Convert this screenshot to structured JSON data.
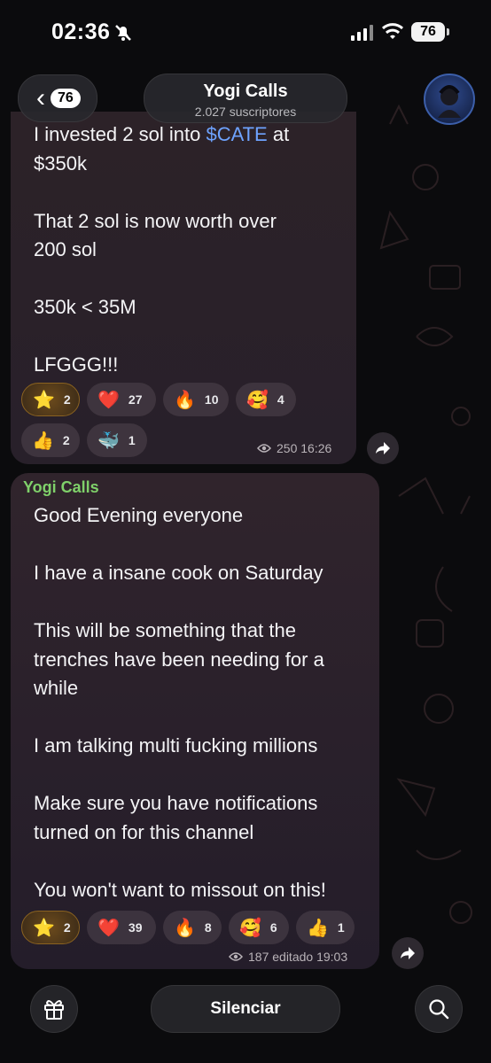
{
  "status_bar": {
    "time": "02:36",
    "battery": "76"
  },
  "header": {
    "back_count": "76",
    "channel_name": "Yogi Calls",
    "subscribers": "2.027 suscriptores"
  },
  "message1": {
    "line1_prefix": "I invested 2 sol into ",
    "line1_link": "$CATE",
    "line1_suffix": " at",
    "body": "$350k\n\nThat 2 sol is now worth over\n200 sol\n\n350k < 35M\n\nLFGGG!!!",
    "reactions": [
      {
        "emoji": "⭐",
        "count": "2"
      },
      {
        "emoji": "❤️",
        "count": "27"
      },
      {
        "emoji": "🔥",
        "count": "10"
      },
      {
        "emoji": "🥰",
        "count": "4"
      },
      {
        "emoji": "👍",
        "count": "2"
      },
      {
        "emoji": "🐳",
        "count": "1"
      }
    ],
    "meta": "250 16:26"
  },
  "message2": {
    "sender": "Yogi Calls",
    "body": "Good Evening everyone\n\nI have a insane cook on Saturday\n\nThis will be something that the\ntrenches have been needing for a\nwhile\n\nI am talking multi fucking millions\n\nMake sure you have notifications\nturned on for this channel\n\nYou won't want to missout on this!",
    "reactions": [
      {
        "emoji": "⭐",
        "count": "2"
      },
      {
        "emoji": "❤️",
        "count": "39"
      },
      {
        "emoji": "🔥",
        "count": "8"
      },
      {
        "emoji": "🥰",
        "count": "6"
      },
      {
        "emoji": "👍",
        "count": "1"
      }
    ],
    "meta": "187 editado 19:03"
  },
  "bottom_bar": {
    "mute_label": "Silenciar"
  },
  "icons": [
    "bell-slash-icon",
    "signal-icon",
    "wifi-icon",
    "battery-icon",
    "chevron-left-icon",
    "eye-icon",
    "share-icon",
    "gift-icon",
    "search-icon"
  ]
}
